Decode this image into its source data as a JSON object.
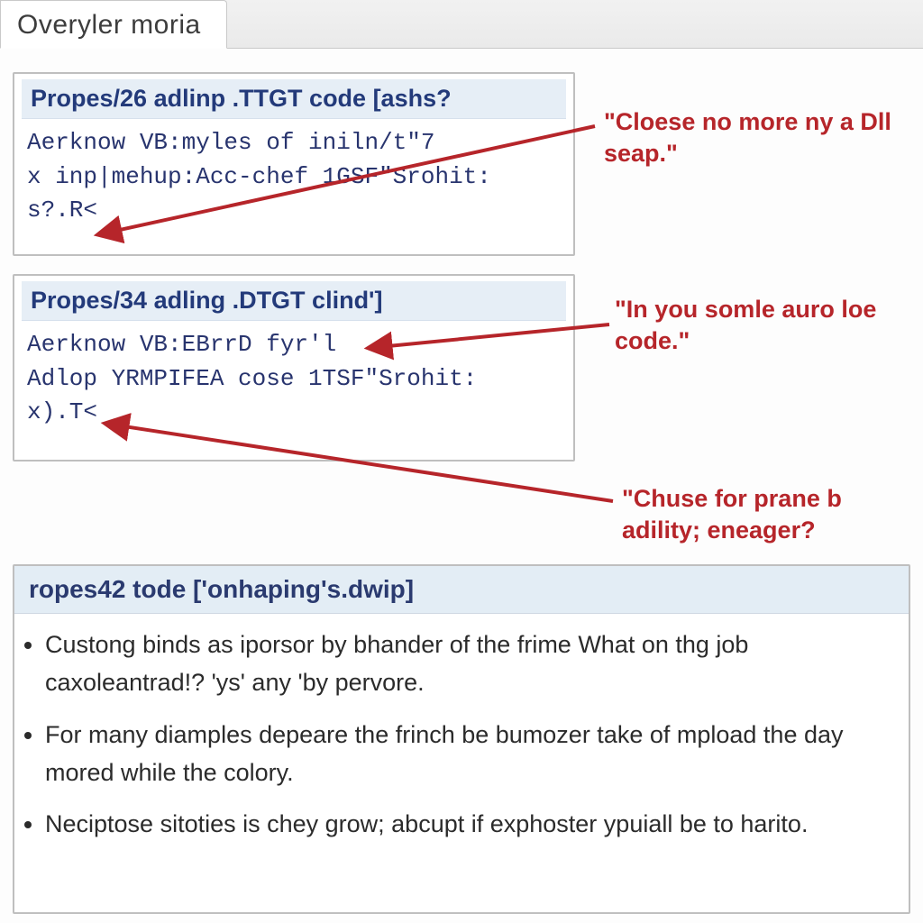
{
  "tab": {
    "label": "Overyler moria"
  },
  "panel1": {
    "title": "Propes/26 adlinp .TTGT code [ashs?",
    "code": "Aerknow VB:myles of iniln/t\"7\nx inp|mehup:Acc-chef 1GSF\"Srohit:\ns?.R<"
  },
  "panel2": {
    "title": "Propes/34 adling .DTGT clind']",
    "code": "Aerknow VB:EBrrD fyr'l\nAdlop YRMPIFEA cose 1TSF\"Srohit:\nx).T<"
  },
  "panel3": {
    "title": "ropes42 tode ['onhaping's.dwip]",
    "bullets": [
      "Custong binds as iporsor by bhander of the frime What on thg job caxoleantrad!? 'ys' any 'by pervore.",
      "For many diamples depeare the frinch be bumozer take of mpload the day mored while the colory.",
      "Neciptose sitoties is chey grow; abcupt if exphoster ypuiall be to harito."
    ]
  },
  "annotations": {
    "a1": "\"Cloese no more\nny a Dll seap.\"",
    "a2": "\"In you somle auro\nloe code.\"",
    "a3": "\"Chuse for prane b\nadility; eneager?"
  }
}
